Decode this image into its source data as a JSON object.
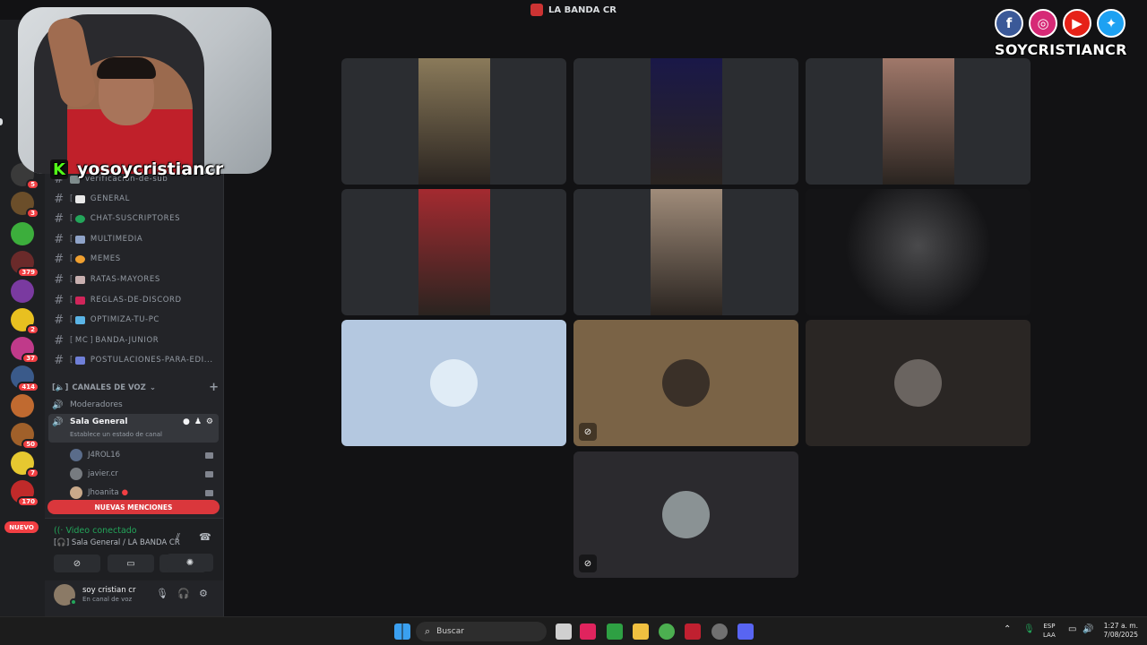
{
  "window": {
    "title": "LA BANDA CR"
  },
  "rail": {
    "badges": [
      "5",
      "3",
      "379",
      "2",
      "37",
      "414",
      "50",
      "7",
      "170"
    ],
    "new_label": "NUEVO"
  },
  "channels": {
    "text": [
      {
        "name": "verificacion-de-sub",
        "color": "#7f8c8d"
      },
      {
        "name": "general",
        "color": "#e8e8e8"
      },
      {
        "name": "chat-suscriptores",
        "color": "#23a55a"
      },
      {
        "name": "multimedia",
        "color": "#8fa3c8"
      },
      {
        "name": "memes",
        "color": "#f0a030"
      },
      {
        "name": "ratas-mayores",
        "color": "#c8b0b0"
      },
      {
        "name": "reglas-de-discord",
        "color": "#d0255a"
      },
      {
        "name": "optimiza-tu-pc",
        "color": "#5ab4e6"
      },
      {
        "name": "banda-junior",
        "color": "",
        "prefix": "MC"
      },
      {
        "name": "postulaciones-para-edi...",
        "color": "#6f7fd8"
      }
    ],
    "voice_category": "CANALES DE VOZ",
    "voice": [
      {
        "name": "Moderadores"
      },
      {
        "name": "Sala General",
        "status": "Establece un estado de canal"
      }
    ],
    "members": [
      {
        "name": "J4ROL16",
        "color": "#5a6c8a"
      },
      {
        "name": "javier.cr",
        "color": "#777b80"
      },
      {
        "name": "Jhoanita",
        "color": "#c9a98a"
      }
    ],
    "mentions_label": "NUEVAS MENCIONES"
  },
  "voice_panel": {
    "connected": "Video conectado",
    "location": "Sala General / LA BANDA CR"
  },
  "user": {
    "name": "soy cristian cr",
    "status": "En canal de voz"
  },
  "overlay": {
    "streamer": "yosoycristiancr",
    "social_name": "SOYCRISTIANCR",
    "social_icons": [
      "facebook-icon",
      "instagram-icon",
      "youtube-icon",
      "twitter-icon"
    ],
    "brand_colors": {
      "facebook": "#3b5998",
      "instagram": "#d62976",
      "youtube": "#e62117",
      "twitter": "#1da1f2"
    }
  },
  "grid": {
    "tiles": [
      {
        "kind": "video",
        "bg": "#8a7a5a"
      },
      {
        "kind": "video",
        "bg": "#1a1848"
      },
      {
        "kind": "video",
        "bg": "#a0786a"
      },
      {
        "kind": "video",
        "bg": "#a42a30"
      },
      {
        "kind": "video",
        "bg": "#a08c7a"
      },
      {
        "kind": "dark-video",
        "bg": "#141416"
      },
      {
        "kind": "avatar",
        "bg": "#b4c8e0",
        "avatar": "#e0ecf6",
        "camoff": false
      },
      {
        "kind": "avatar",
        "bg": "#7a6346",
        "avatar": "#3a3028",
        "camoff": true
      },
      {
        "kind": "avatar",
        "bg": "#2a2624",
        "avatar": "#6a6460",
        "camoff": false
      },
      {
        "kind": "avatar",
        "bg": "#2b2a2e",
        "avatar": "#8a9294",
        "camoff": true
      }
    ]
  },
  "taskbar": {
    "search_placeholder": "Buscar",
    "lang_top": "ESP",
    "lang_bottom": "LAA",
    "time": "1:27 a. m.",
    "date": "7/08/2025"
  }
}
